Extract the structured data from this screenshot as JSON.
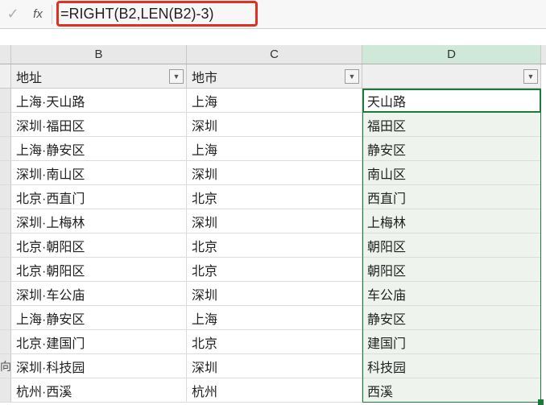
{
  "formula_bar": {
    "fx_label": "fx",
    "formula": "=RIGHT(B2,LEN(B2)-3)"
  },
  "columns": {
    "B": "B",
    "C": "C",
    "D": "D"
  },
  "headers": {
    "B": "地址",
    "C": "地市",
    "D": ""
  },
  "row_stub_last": "向",
  "rows": [
    {
      "B": "上海·天山路",
      "C": "上海",
      "D": "天山路"
    },
    {
      "B": "深圳·福田区",
      "C": "深圳",
      "D": "福田区"
    },
    {
      "B": "上海·静安区",
      "C": "上海",
      "D": "静安区"
    },
    {
      "B": "深圳·南山区",
      "C": "深圳",
      "D": "南山区"
    },
    {
      "B": "北京·西直门",
      "C": "北京",
      "D": "西直门"
    },
    {
      "B": "深圳·上梅林",
      "C": "深圳",
      "D": "上梅林"
    },
    {
      "B": "北京·朝阳区",
      "C": "北京",
      "D": "朝阳区"
    },
    {
      "B": "北京·朝阳区",
      "C": "北京",
      "D": "朝阳区"
    },
    {
      "B": "深圳·车公庙",
      "C": "深圳",
      "D": "车公庙"
    },
    {
      "B": "上海·静安区",
      "C": "上海",
      "D": "静安区"
    },
    {
      "B": "北京·建国门",
      "C": "北京",
      "D": "建国门"
    },
    {
      "B": "深圳·科技园",
      "C": "深圳",
      "D": "科技园"
    },
    {
      "B": "杭州·西溪",
      "C": "杭州",
      "D": "西溪"
    }
  ]
}
